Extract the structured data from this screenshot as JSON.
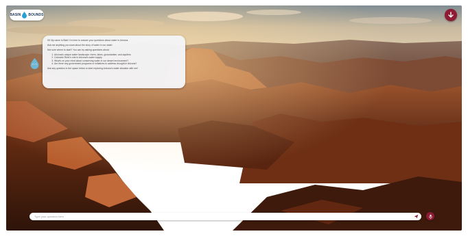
{
  "brand": {
    "logo_left": "BASIN",
    "logo_right": "BOUNDS"
  },
  "header": {
    "scroll_icon": "arrow-down-icon"
  },
  "colors": {
    "accent": "#8e1c34",
    "bubble_bg": "#f4f4f6",
    "sky": "#b9b4a6",
    "canyon": "#8a3e1c"
  },
  "chat": {
    "intro": "Hi! My name is Blair! I'm here to answer your questions about water in Arizona.",
    "ask": "Ask me anything you want about the story of water in our state!",
    "prompt": "Not sure where to start? You can try asking questions about:",
    "suggestions": [
      "Arizona's unique water landscape: rivers, lakes, groundwater, and aquifers",
      "Colorado River's role in Arizona's water supply",
      "What's on your mind about conserving water in our desert environment?",
      "Are there any government programs or initiatives to address drought in Arizona?"
    ],
    "closing": "Ask any question in the space below to start exploring Arizona's water situation with me!"
  },
  "input": {
    "placeholder": "Type your question here",
    "send_icon": "send-icon",
    "mic_icon": "mic-icon"
  }
}
